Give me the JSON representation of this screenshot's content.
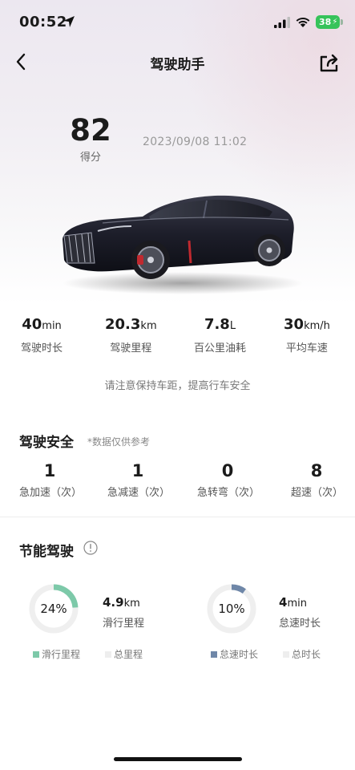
{
  "status_bar": {
    "time": "00:52",
    "battery": "38"
  },
  "nav": {
    "title": "驾驶助手"
  },
  "score": {
    "value": "82",
    "label": "得分"
  },
  "datetime": "2023/09/08 11:02",
  "stats": [
    {
      "value": "40",
      "unit": "min",
      "label": "驾驶时长"
    },
    {
      "value": "20.3",
      "unit": "km",
      "label": "驾驶里程"
    },
    {
      "value": "7.8",
      "unit": "L",
      "label": "百公里油耗"
    },
    {
      "value": "30",
      "unit": "km/h",
      "label": "平均车速"
    }
  ],
  "notice": "请注意保持车距，提高行车安全",
  "safety": {
    "title": "驾驶安全",
    "note": "*数据仅供参考",
    "items": [
      {
        "value": "1",
        "label": "急加速（次）"
      },
      {
        "value": "1",
        "label": "急减速（次）"
      },
      {
        "value": "0",
        "label": "急转弯（次）"
      },
      {
        "value": "8",
        "label": "超速（次）"
      }
    ]
  },
  "eco": {
    "title": "节能驾驶",
    "coasting": {
      "percent": 24,
      "percent_label": "24%",
      "value": "4.9",
      "unit": "km",
      "label": "滑行里程",
      "legend_a": "滑行里程",
      "legend_b": "总里程",
      "color": "#7dc9a9"
    },
    "idle": {
      "percent": 10,
      "percent_label": "10%",
      "value": "4",
      "unit": "min",
      "label": "怠速时长",
      "legend_a": "怠速时长",
      "legend_b": "总时长",
      "color": "#6f87a8"
    }
  }
}
